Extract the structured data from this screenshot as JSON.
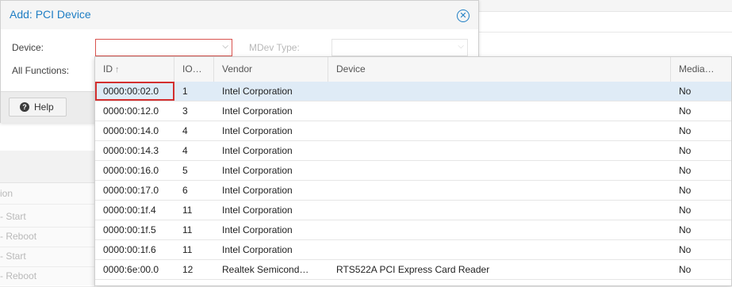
{
  "dialog": {
    "title": "Add: PCI Device",
    "device_label": "Device:",
    "device_value": "",
    "mdev_label": "MDev Type:",
    "all_functions_label": "All Functions:",
    "help_label": "Help"
  },
  "background": {
    "rows": [
      "ion",
      "- Start",
      "- Reboot",
      "- Start",
      "- Reboot"
    ]
  },
  "grid": {
    "columns": {
      "id": "ID",
      "io": "IO…",
      "vendor": "Vendor",
      "device": "Device",
      "media": "Media…"
    },
    "rows": [
      {
        "id": "0000:00:02.0",
        "io": "1",
        "vendor": "Intel Corporation",
        "device": "",
        "media": "No"
      },
      {
        "id": "0000:00:12.0",
        "io": "3",
        "vendor": "Intel Corporation",
        "device": "",
        "media": "No"
      },
      {
        "id": "0000:00:14.0",
        "io": "4",
        "vendor": "Intel Corporation",
        "device": "",
        "media": "No"
      },
      {
        "id": "0000:00:14.3",
        "io": "4",
        "vendor": "Intel Corporation",
        "device": "",
        "media": "No"
      },
      {
        "id": "0000:00:16.0",
        "io": "5",
        "vendor": "Intel Corporation",
        "device": "",
        "media": "No"
      },
      {
        "id": "0000:00:17.0",
        "io": "6",
        "vendor": "Intel Corporation",
        "device": "",
        "media": "No"
      },
      {
        "id": "0000:00:1f.4",
        "io": "11",
        "vendor": "Intel Corporation",
        "device": "",
        "media": "No"
      },
      {
        "id": "0000:00:1f.5",
        "io": "11",
        "vendor": "Intel Corporation",
        "device": "",
        "media": "No"
      },
      {
        "id": "0000:00:1f.6",
        "io": "11",
        "vendor": "Intel Corporation",
        "device": "",
        "media": "No"
      },
      {
        "id": "0000:6e:00.0",
        "io": "12",
        "vendor": "Realtek Semicond…",
        "device": "RTS522A PCI Express Card Reader",
        "media": "No"
      }
    ]
  },
  "colors": {
    "accent": "#1f7ec4",
    "selected_row": "#dfebf6",
    "focus_outline": "#d32f2f"
  },
  "icons": {
    "close": "close-circle-icon",
    "help": "question-circle-icon",
    "sort": "arrow-up-icon",
    "dropdown": "chevron-down-icon"
  }
}
